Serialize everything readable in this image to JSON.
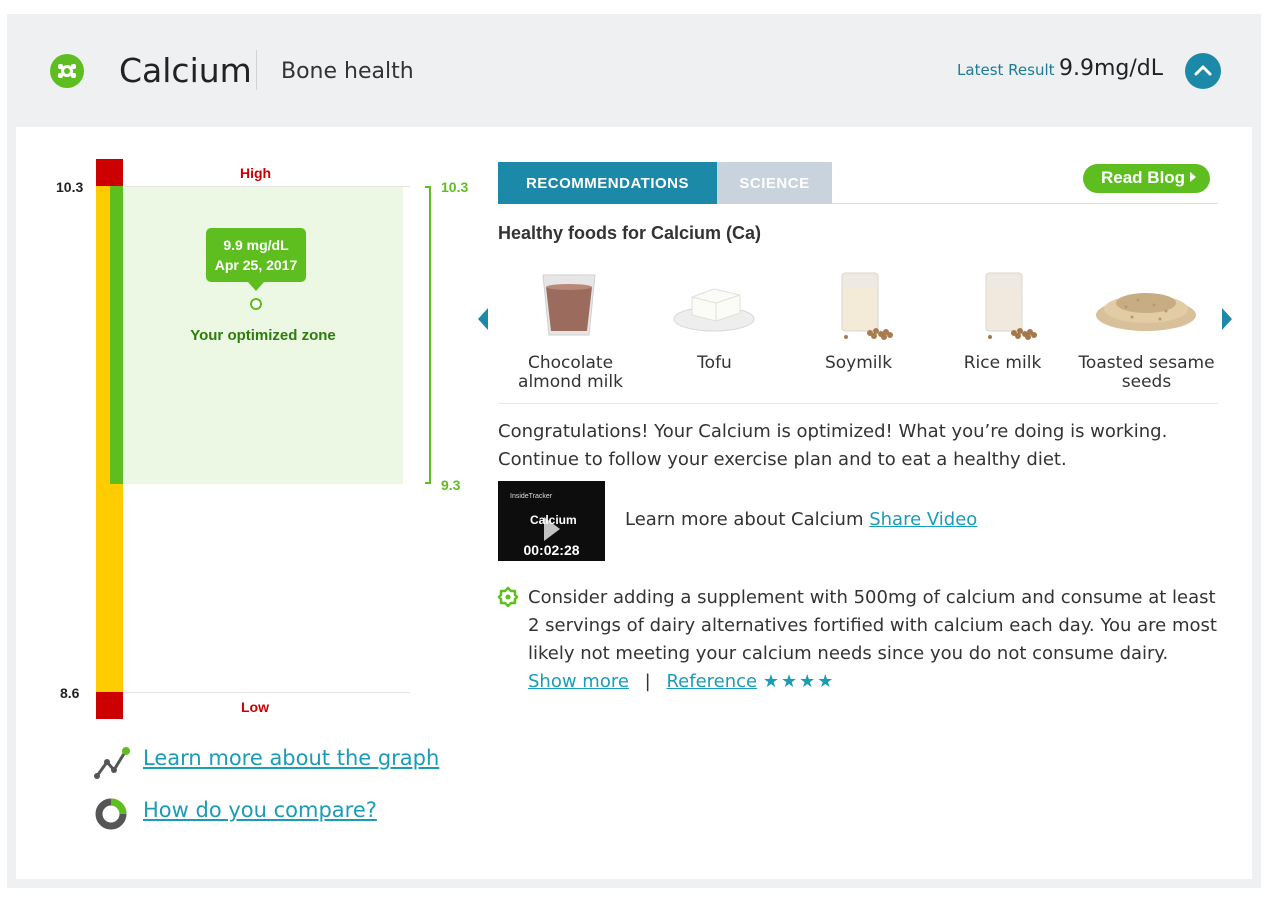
{
  "header": {
    "title": "Calcium",
    "subtitle": "Bone health",
    "latest_label": "Latest Result",
    "latest_value": "9.9mg/dL"
  },
  "gauge": {
    "max_label": "10.3",
    "min_label": "8.6",
    "high_label": "High",
    "low_label": "Low",
    "zone_top_label": "10.3",
    "zone_bottom_label": "9.3",
    "result_value": "9.9 mg/dL",
    "result_date": "Apr 25, 2017",
    "zone_label": "Your optimized zone",
    "links": {
      "graph": "Learn more about the graph",
      "compare": "How do you compare?"
    }
  },
  "tabs": {
    "recommendations": "RECOMMENDATIONS",
    "science": "SCIENCE",
    "read_blog": "Read Blog"
  },
  "foods": {
    "title": "Healthy foods for Calcium (Ca)",
    "items": [
      {
        "name": "Chocolate almond milk"
      },
      {
        "name": "Tofu"
      },
      {
        "name": "Soymilk"
      },
      {
        "name": "Rice milk"
      },
      {
        "name": "Toasted sesame seeds"
      }
    ]
  },
  "message": "Congratulations! Your Calcium is optimized! What you’re doing is working. Continue to follow your exercise plan and to eat a healthy diet.",
  "video": {
    "brand": "InsideTracker",
    "thumb_title": "Calcium",
    "duration": "00:02:28",
    "text": "Learn more about Calcium",
    "share": "Share Video"
  },
  "supplement": {
    "text": "Consider adding a supplement with 500mg of calcium and consume at least 2 servings of dairy alternatives fortified with calcium each day. You are most likely not meeting your calcium needs since you do not consume dairy.",
    "show_more": "Show more",
    "separator": "|",
    "reference": "Reference",
    "stars": "★★★★"
  },
  "colors": {
    "accent": "#1d89a8",
    "green": "#5fbe1f",
    "red": "#cc0000",
    "yellow": "#ffcc00",
    "link": "#1b9cb6"
  }
}
